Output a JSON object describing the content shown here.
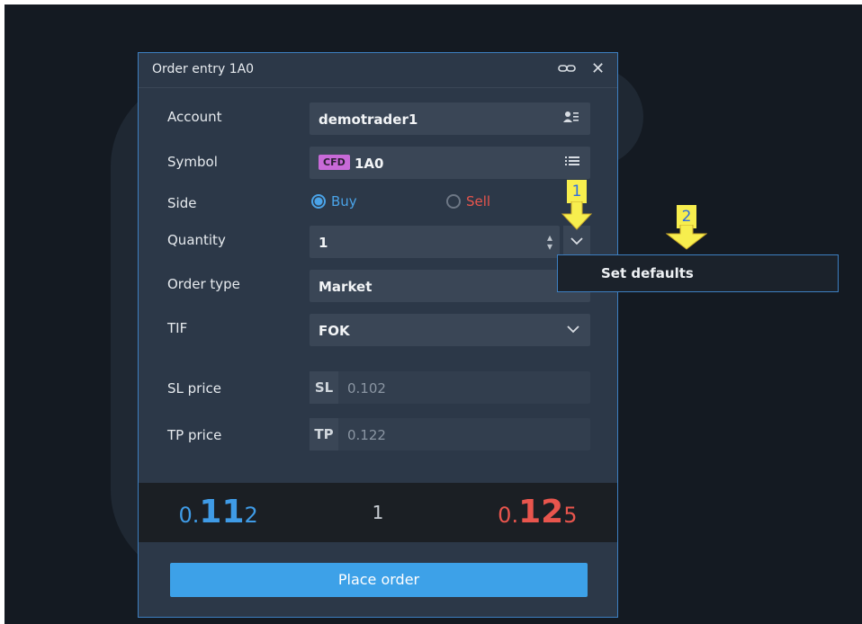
{
  "window": {
    "title": "Order entry 1A0",
    "link_icon": "link-icon",
    "close_icon": "close-icon"
  },
  "form": {
    "account": {
      "label": "Account",
      "value": "demotrader1",
      "icon": "account-icon"
    },
    "symbol": {
      "label": "Symbol",
      "badge": "CFD",
      "value": "1A0",
      "icon": "list-icon"
    },
    "side": {
      "label": "Side",
      "options": [
        "Buy",
        "Sell"
      ],
      "selected": "Buy"
    },
    "quantity": {
      "label": "Quantity",
      "value": "1"
    },
    "order_type": {
      "label": "Order type",
      "value": "Market"
    },
    "tif": {
      "label": "TIF",
      "value": "FOK"
    },
    "sl": {
      "label": "SL price",
      "prefix": "SL",
      "placeholder": "0.102"
    },
    "tp": {
      "label": "TP price",
      "prefix": "TP",
      "placeholder": "0.122"
    }
  },
  "quotes": {
    "bid_small": "0.",
    "bid_big": "11",
    "bid_tail": "2",
    "spread": "1",
    "ask_small": "0.",
    "ask_big": "12",
    "ask_tail": "5"
  },
  "place_order_label": "Place order",
  "dropdown_menu": {
    "items": [
      "Set defaults"
    ]
  },
  "callouts": [
    "1",
    "2"
  ],
  "colors": {
    "accent": "#3da1e8",
    "bid": "#3f9be6",
    "ask": "#e8554d",
    "callout": "#f7ee4e",
    "cfd_badge": "#c86ad8"
  }
}
